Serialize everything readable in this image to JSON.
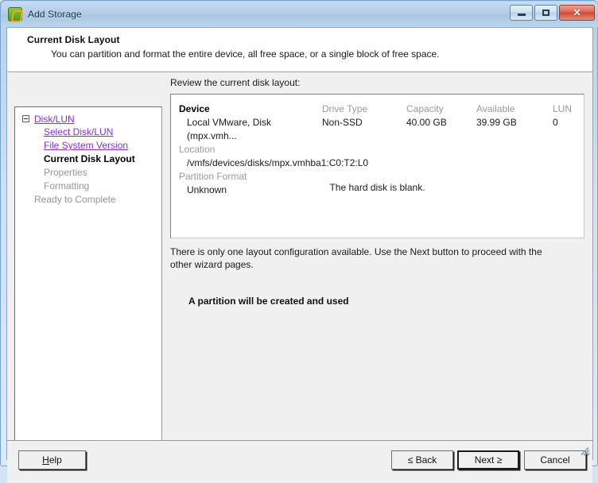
{
  "window": {
    "title": "Add Storage",
    "icon": "add-storage-icon",
    "controls": {
      "minimize": "Minimize",
      "maximize": "Maximize",
      "close": "Close"
    }
  },
  "header": {
    "title": "Current Disk Layout",
    "subtitle": "You can partition and format the entire device, all free space, or a single block of free space."
  },
  "sidebar": {
    "root": {
      "label": "Disk/LUN",
      "state": "expanded"
    },
    "items": [
      {
        "label": "Select Disk/LUN",
        "state": "link",
        "indent": 1
      },
      {
        "label": "File System Version",
        "state": "link",
        "indent": 1
      },
      {
        "label": "Current Disk Layout",
        "state": "current",
        "indent": 1
      },
      {
        "label": "Properties",
        "state": "disabled",
        "indent": 1
      },
      {
        "label": "Formatting",
        "state": "disabled",
        "indent": 1
      },
      {
        "label": "Ready to Complete",
        "state": "disabled",
        "indent": 0
      }
    ]
  },
  "main": {
    "review_label": "Review the current disk layout:",
    "table": {
      "columns": [
        "Device",
        "Drive Type",
        "Capacity",
        "Available",
        "LUN"
      ],
      "row": {
        "device": "Local VMware, Disk (mpx.vmh...",
        "drive_type": "Non-SSD",
        "capacity": "40.00 GB",
        "available": "39.99 GB",
        "lun": "0"
      },
      "location_label": "Location",
      "location_value": "/vmfs/devices/disks/mpx.vmhba1:C0:T2:L0",
      "partition_format_label": "Partition Format",
      "partition_format_value": "Unknown"
    },
    "blank_message": "The hard disk is blank.",
    "note": "There is only one layout configuration available. Use the Next button to proceed with the other wizard pages.",
    "partition_message": "A partition will be created and used"
  },
  "footer": {
    "help": "Help",
    "help_accesskey": "H",
    "back": "≤ Back",
    "next": "Next ≥",
    "cancel": "Cancel"
  },
  "colors": {
    "link": "#8a2be2",
    "disabled_text": "#969696",
    "header_text": "#9a9a9a",
    "titlebar_accent": "#a8c6e2",
    "close_button": "#cf4a33"
  }
}
